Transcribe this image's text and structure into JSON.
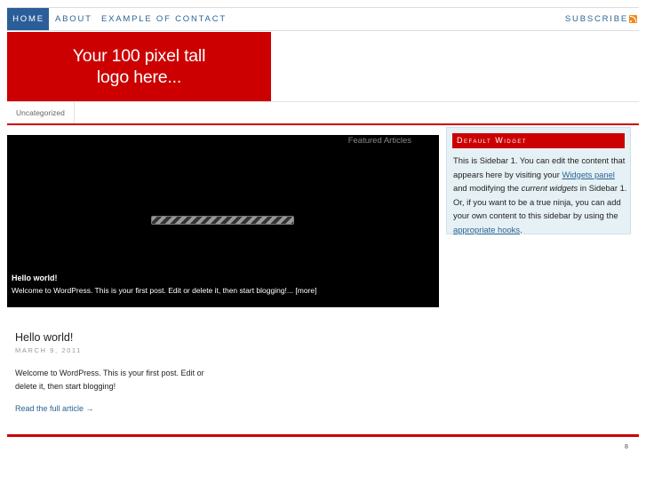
{
  "nav": {
    "items": [
      {
        "label": "HOME"
      },
      {
        "label": "ABOUT"
      },
      {
        "label": "EXAMPLE OF CONTACT"
      }
    ],
    "subscribe": "SUBSCRIBE",
    "rss_icon": "rss-icon"
  },
  "logo": {
    "text": "Your 100 pixel tall logo here..."
  },
  "categories": [
    "Uncategorized"
  ],
  "featured": {
    "heading": "Featured Articles",
    "post_title": "Hello world!",
    "excerpt": "Welcome to WordPress. This is your first post. Edit or delete it, then start blogging!...",
    "more": "[more]"
  },
  "widget": {
    "title": "Default Widget",
    "text_1": "This is Sidebar 1. You can edit the content that appears here by visiting your ",
    "link_1": "Widgets panel",
    "text_2": " and modifying the ",
    "em": "current widgets",
    "text_3": " in Sidebar 1. Or, if you want to be a true ninja, you can add your own content to this sidebar by using the ",
    "link_2": "appropriate hooks",
    "text_4": "."
  },
  "post": {
    "title": "Hello world!",
    "date": "MARCH 9, 2011",
    "body": "Welcome to WordPress. This is your first post. Edit or delete it, then start blogging!",
    "read_more": "Read the full article →"
  },
  "footer": {
    "mark": "8"
  },
  "colors": {
    "accent_red": "#cc0000",
    "nav_active": "#2b5d99",
    "link": "#2a6496",
    "widget_bg": "#e6f1f5"
  }
}
